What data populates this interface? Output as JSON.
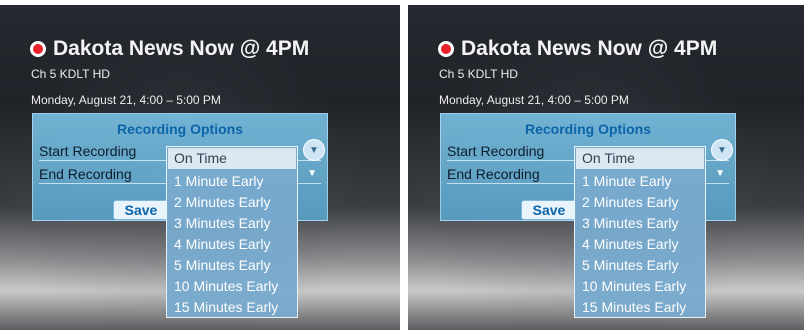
{
  "program": {
    "title": "Dakota News Now @ 4PM",
    "channel": "Ch 5  KDLT HD",
    "datetime": "Monday, August 21,  4:00 – 5:00 PM",
    "recording_indicator_color": "#e8202a"
  },
  "recording_options": {
    "header": "Recording Options",
    "start_label": "Start Recording",
    "end_label": "End Recording",
    "save_label": "Save",
    "accent_color": "#0b64a8"
  },
  "dropdown": {
    "selected": "On Time",
    "options": [
      "1 Minute Early",
      "2 Minutes Early",
      "3 Minutes Early",
      "4 Minutes Early",
      "5 Minutes Early",
      "10 Minutes Early",
      "15 Minutes Early"
    ]
  },
  "icons": {
    "record": "record-dot-icon",
    "chevron": "chevron-down-icon"
  }
}
